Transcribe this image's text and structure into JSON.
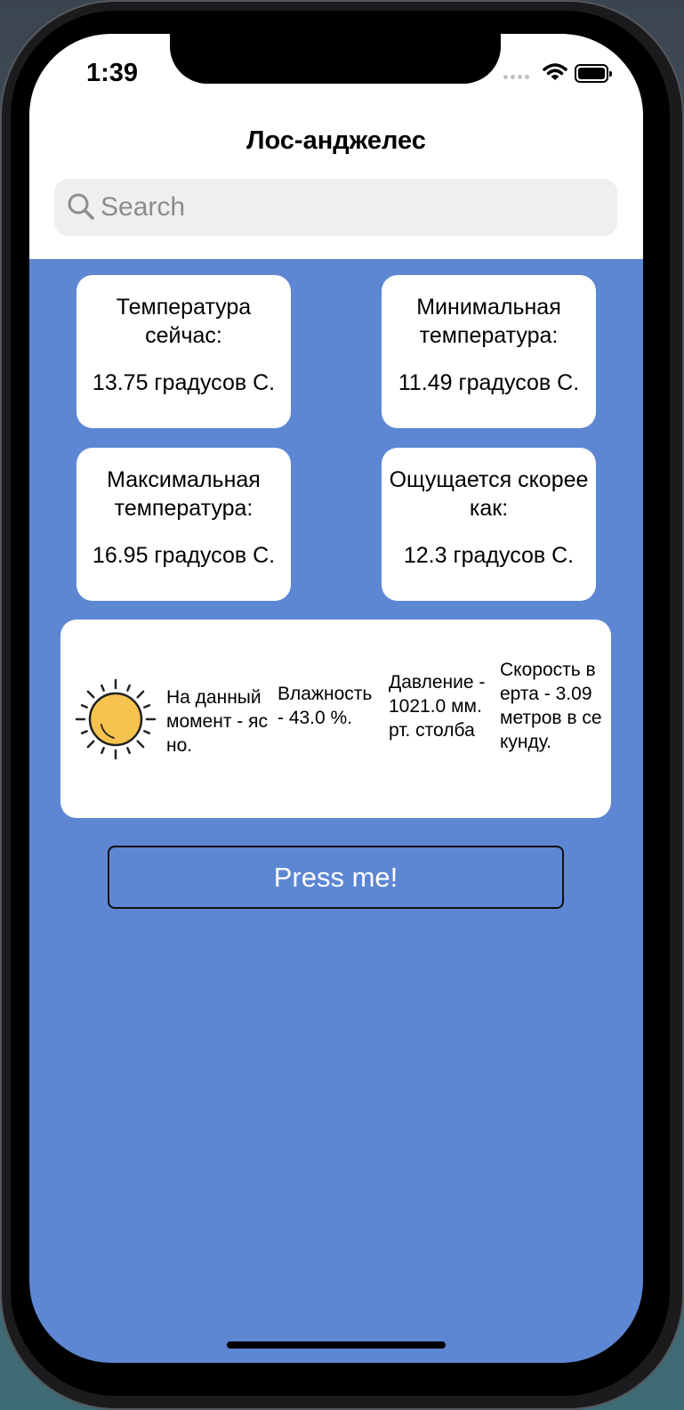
{
  "status_bar": {
    "time": "1:39"
  },
  "header": {
    "title": "Лос-анджелес"
  },
  "search": {
    "placeholder": "Search",
    "value": ""
  },
  "cards": [
    {
      "label": "Температура сейчас:",
      "value": "13.75 градусов С."
    },
    {
      "label": "Минимальная температура:",
      "value": "11.49 градусов С."
    },
    {
      "label": "Максимальная температура:",
      "value": "16.95 градусов С."
    },
    {
      "label": "Ощущается скорее как:",
      "value": "12.3 градусов С."
    }
  ],
  "details": {
    "weather_icon": "sun-icon",
    "weather": "На данный момент - ясно.",
    "humidity": "Влажность - 43.0 %.",
    "pressure": "Давление - 1021.0 мм. рт. столба",
    "wind": "Скорость верта - 3.09 метров в секунду."
  },
  "button": {
    "label": "Press me!"
  },
  "colors": {
    "background": "#5d87d3",
    "card": "#ffffff",
    "search_field": "#efefef",
    "sun": "#f6c34f",
    "button_text": "#ffffff"
  }
}
